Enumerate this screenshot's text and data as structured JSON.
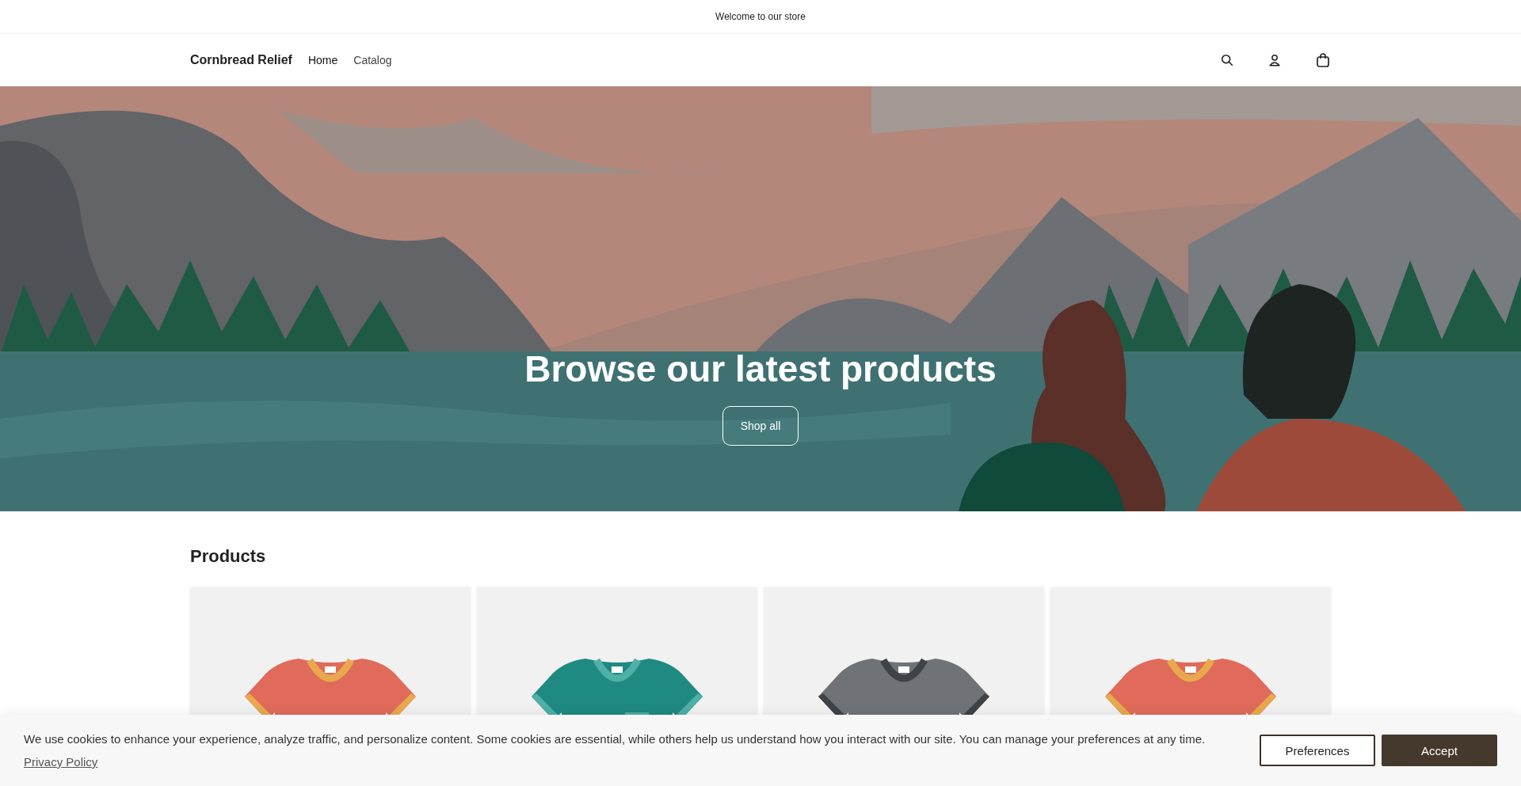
{
  "announcement": "Welcome to our store",
  "header": {
    "brand": "Cornbread Relief",
    "nav": [
      {
        "label": "Home",
        "selected": true
      },
      {
        "label": "Catalog",
        "selected": false
      }
    ]
  },
  "hero": {
    "heading": "Browse our latest products",
    "button": "Shop all"
  },
  "products": {
    "title": "Products",
    "items": [
      {
        "kind": "ringer",
        "color": "#e06b5a"
      },
      {
        "kind": "pocket",
        "color": "#1f8a82"
      },
      {
        "kind": "graphic",
        "color": "#6f7378"
      },
      {
        "kind": "ringer",
        "color": "#e06b5a"
      }
    ]
  },
  "cookie_banner": {
    "text": "We use cookies to enhance your experience, analyze traffic, and personalize content. Some cookies are essential, while others help us understand how you interact with our site. You can manage your preferences at any time.",
    "link": "Privacy Policy",
    "buttons": [
      {
        "kind": "outline",
        "label": "Preferences"
      },
      {
        "kind": "filled",
        "label": "Accept"
      }
    ]
  }
}
